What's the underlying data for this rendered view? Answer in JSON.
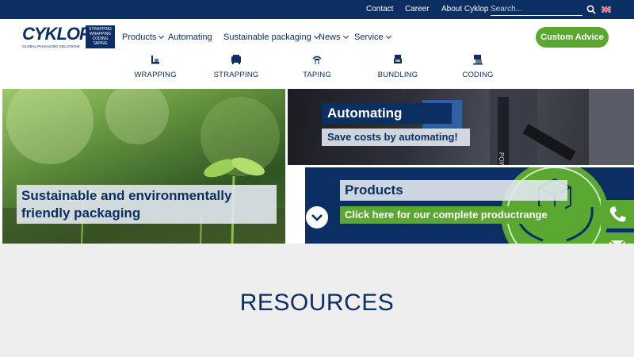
{
  "topbar": {
    "links": [
      "Contact",
      "Career",
      "About Cyklop"
    ],
    "search_placeholder": "Search..."
  },
  "logo": {
    "name": "CYKLOP",
    "tagline": "GLOBAL PACKAGING SOLUTIONS",
    "box_lines": [
      "STRAPPING",
      "WRAPPING",
      "CODING",
      "TAPING"
    ]
  },
  "nav": {
    "items": [
      "Products",
      "Automating",
      "Sustainable packaging",
      "News",
      "Service"
    ],
    "cta": "Custom Advice"
  },
  "categories": [
    {
      "label": "WRAPPING",
      "icon": "wrapping-icon"
    },
    {
      "label": "STRAPPING",
      "icon": "strapping-icon"
    },
    {
      "label": "TAPING",
      "icon": "taping-icon"
    },
    {
      "label": "BUNDLING",
      "icon": "bundling-icon"
    },
    {
      "label": "CODING",
      "icon": "coding-icon"
    }
  ],
  "tiles": {
    "sustainable": "Sustainable and environmentally friendly packaging",
    "automating_title": "Automating",
    "automating_sub": "Save costs by automating!",
    "products_title": "Products",
    "products_sub": "Click here for our complete productrange",
    "machine_text": "POWER"
  },
  "resources": {
    "title": "RESOURCES"
  },
  "colors": {
    "navy": "#0b2e63",
    "green": "#5aa731",
    "light_bg": "#eeeeee"
  }
}
